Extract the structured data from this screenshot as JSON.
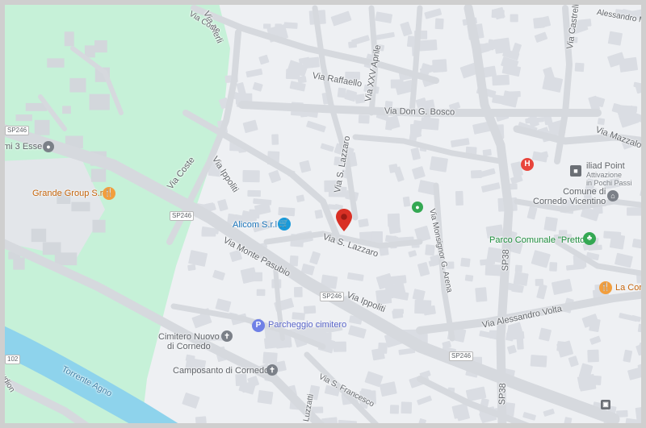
{
  "colors": {
    "background": "#eef0f3",
    "park": "#c6f1d8",
    "river": "#8ed3ec",
    "road": "#ffffff",
    "building": "#dadde3",
    "food": "#f29e3d",
    "shop": "#1a9ad9",
    "parking": "#6f80e6",
    "park_poi": "#34a853",
    "hospital": "#e8453c",
    "marker": "#d93025"
  },
  "streets": {
    "via_merli": "Via Merli",
    "via_coste_top": "Via Coste",
    "via_alessandro_manzoni": "Alessandro Manz",
    "via_castrelli": "Via Castrell",
    "via_raffaello": "Via Raffaello",
    "via_xxv_aprile": "Via XXV Aprile",
    "via_don_bosco": "Via Don G. Bosco",
    "via_mazzalo": "Via Mazzalo",
    "via_coste_mid": "Via Coste",
    "via_ippoliti_top": "Via Ippoliti",
    "via_s_lazzaro_v": "Via S. Lazzaro",
    "via_s_lazzaro_h": "Via S. Lazzaro",
    "via_monsignor_arena": "Via Monsignor G. Arena",
    "via_monte_pasubio": "Via Monte Pasubio",
    "via_ippoliti_bottom": "Via Ippoliti",
    "via_alessandro_volta": "Via Alessandro Volta",
    "sp38_top": "SP38",
    "sp38_bottom": "SP38",
    "via_s_francesco": "Via S. Francesco",
    "via_luzzatti": "Luzzatti",
    "via_ludion": "udion",
    "torrente_agno": "Torrente Agno"
  },
  "shields": {
    "sp246_a": "SP246",
    "sp246_b": "SP246",
    "sp246_c": "SP246",
    "sp246_d": "SP246",
    "r102": "102"
  },
  "pois": {
    "tre_esse": "mi 3 Esse",
    "grande_group": "Grande Group S.r.l",
    "alicom": "Alicom S.r.l",
    "parcheggio": "Parcheggio cimitero",
    "cimitero": "Cimitero Nuovo\ndi Cornedo",
    "camposanto": "Camposanto di Cornedo",
    "iliad": "iliad Point",
    "iliad_sub": "Attivazione\nin Pochi Passi",
    "comune": "Comune di\nCornedo Vicentino",
    "parco": "Parco Comunale \"Pretto\"",
    "la_cor": "La Cor"
  },
  "icons": {
    "food": "restaurant-icon",
    "shop": "shopping-cart-icon",
    "parking": "parking-icon",
    "cemetery": "cemetery-icon",
    "hospital": "hospital-icon",
    "park": "tree-icon",
    "marker": "location-pin-icon",
    "bus": "bus-icon"
  }
}
